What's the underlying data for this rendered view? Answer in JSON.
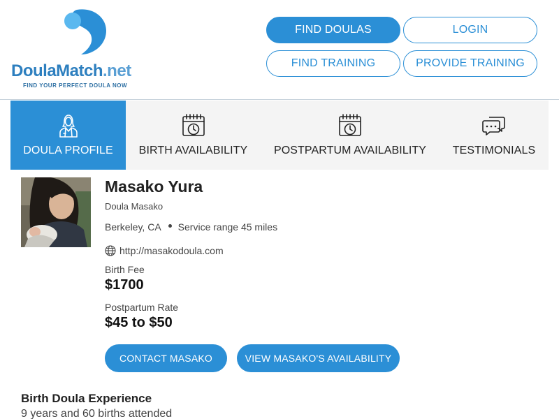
{
  "logo": {
    "name_main": "DoulaMatch",
    "name_suffix": ".net",
    "tagline": "FIND YOUR PERFECT DOULA NOW",
    "colors": {
      "dark": "#2d7fbf",
      "light": "#5ab8ef"
    }
  },
  "nav": {
    "find_doulas": "FIND DOULAS",
    "login": "LOGIN",
    "find_training": "FIND TRAINING",
    "provide_training": "PROVIDE TRAINING"
  },
  "tabs": [
    {
      "label": "DOULA PROFILE",
      "icon": "doula-person-icon",
      "active": true
    },
    {
      "label": "BIRTH AVAILABILITY",
      "icon": "calendar-clock-icon",
      "active": false
    },
    {
      "label": "POSTPARTUM AVAILABILITY",
      "icon": "calendar-clock-icon",
      "active": false
    },
    {
      "label": "TESTIMONIALS",
      "icon": "chat-bubbles-icon",
      "active": false
    }
  ],
  "profile": {
    "name": "Masako Yura",
    "business_name": "Doula Masako",
    "city": "Berkeley, CA",
    "service_range": "Service range 45 miles",
    "website": "http://masakodoula.com",
    "birth_fee_label": "Birth Fee",
    "birth_fee": "$1700",
    "postpartum_rate_label": "Postpartum Rate",
    "postpartum_rate": "$45 to $50"
  },
  "actions": {
    "contact": "CONTACT MASAKO",
    "availability": "VIEW MASAKO'S AVAILABILITY"
  },
  "experience": {
    "title": "Birth Doula Experience",
    "text": "9 years and 60 births attended"
  },
  "colors": {
    "accent": "#2b8fd6",
    "tab_bg": "#f4f4f4"
  }
}
